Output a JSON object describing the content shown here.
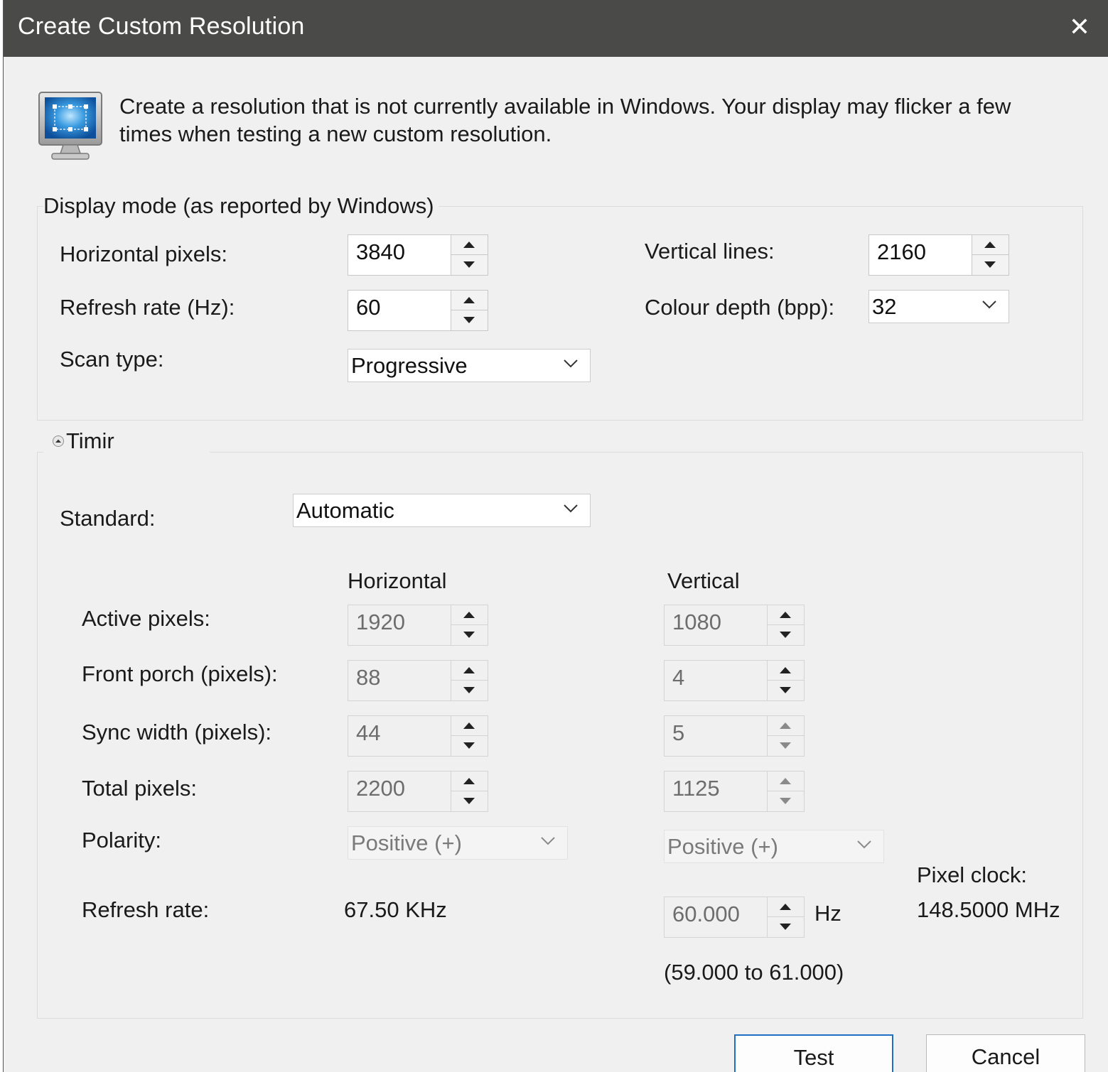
{
  "window": {
    "title": "Create Custom Resolution",
    "close_glyph": "✕"
  },
  "intro": {
    "text": "Create a resolution that is not currently available in Windows. Your display may flicker a few times when testing a new custom resolution.",
    "icon": "monitor-icon"
  },
  "display_mode": {
    "legend": "Display mode (as reported by Windows)",
    "horizontal_pixels": {
      "label": "Horizontal pixels:",
      "value": "3840"
    },
    "vertical_lines": {
      "label": "Vertical lines:",
      "value": "2160"
    },
    "refresh_rate": {
      "label": "Refresh rate (Hz):",
      "value": "60"
    },
    "colour_depth": {
      "label": "Colour depth (bpp):",
      "value": "32"
    },
    "scan_type": {
      "label": "Scan type:",
      "value": "Progressive"
    }
  },
  "timing": {
    "legend": "Timir",
    "standard": {
      "label": "Standard:",
      "value": "Automatic"
    },
    "col_horizontal": "Horizontal",
    "col_vertical": "Vertical",
    "rows": {
      "active": {
        "label": "Active pixels:",
        "h": "1920",
        "v": "1080"
      },
      "front_porch": {
        "label": "Front porch (pixels):",
        "h": "88",
        "v": "4"
      },
      "sync_width": {
        "label": "Sync width (pixels):",
        "h": "44",
        "v": "5"
      },
      "total": {
        "label": "Total pixels:",
        "h": "2200",
        "v": "1125"
      }
    },
    "polarity": {
      "label": "Polarity:",
      "h": "Positive (+)",
      "v": "Positive (+)"
    },
    "refresh": {
      "label": "Refresh rate:",
      "h": "67.50 KHz",
      "v": "60.000",
      "unit": "Hz",
      "range": "(59.000 to 61.000)"
    },
    "pixel_clock": {
      "label": "Pixel clock:",
      "value": "148.5000 MHz"
    }
  },
  "buttons": {
    "test": "Test",
    "cancel": "Cancel"
  }
}
